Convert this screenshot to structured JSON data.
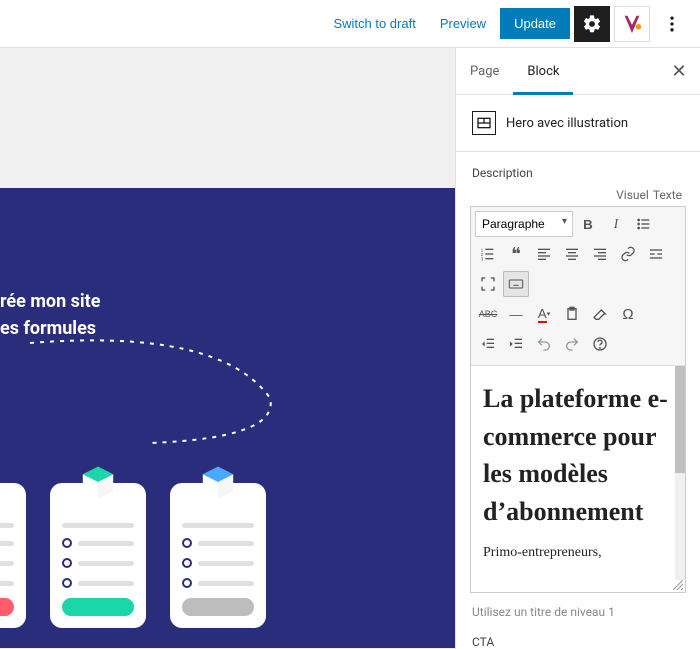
{
  "topbar": {
    "switch_draft": "Switch to draft",
    "preview": "Preview",
    "update": "Update"
  },
  "sidebar": {
    "tabs": {
      "page": "Page",
      "block": "Block"
    },
    "block_type_label": "Hero avec illustration",
    "description_label": "Description",
    "editor_tabs": {
      "visual": "Visuel",
      "text": "Texte"
    },
    "format_select": "Paragraphe",
    "editor_heading": "La plateforme e-commerce pour les modèles d’abonnement",
    "editor_para": "Primo-entrepreneurs,",
    "hint": "Utilisez un titre de niveau 1",
    "cta_label": "CTA"
  },
  "hero": {
    "line1": "rée mon site",
    "line2": "es formules"
  },
  "colors": {
    "primary": "#007cba",
    "hero_bg": "#2a2d7c",
    "accent_red": "#ff5c6c",
    "accent_teal": "#1ad6a8"
  }
}
